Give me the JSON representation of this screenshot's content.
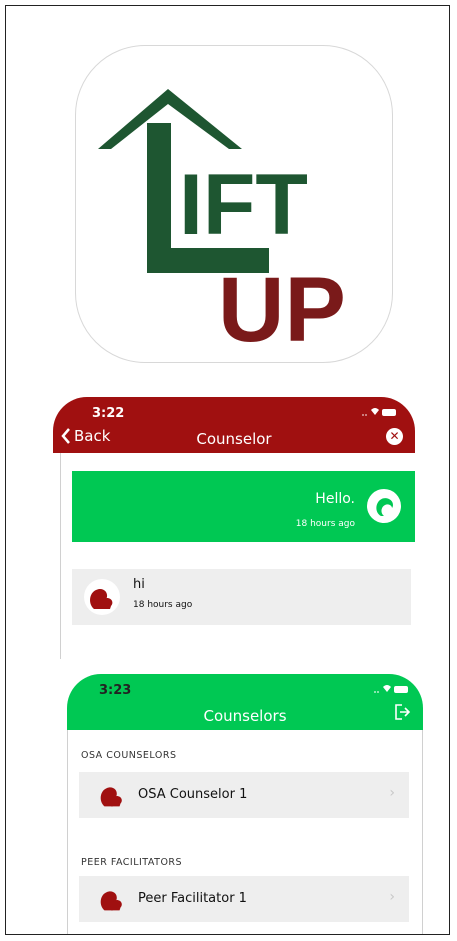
{
  "colors": {
    "logo_green": "#1e5631",
    "logo_maroon": "#7a1a1a",
    "nav_red": "#a01010",
    "nav_green": "#00c853",
    "bubble_grey": "#eeeeee"
  },
  "app_icon": {
    "logo_text_line1": "LIFT",
    "logo_text_line2": "UP"
  },
  "chat_screen": {
    "status_time": "3:22",
    "back_label": "Back",
    "title": "Counselor",
    "close_icon": "close-circle-icon",
    "messages": [
      {
        "text": "Hello.",
        "time": "18 hours ago",
        "side": "right"
      },
      {
        "text": "hi",
        "time": "18 hours ago",
        "side": "left"
      }
    ]
  },
  "counselors_screen": {
    "status_time": "3:23",
    "title": "Counselors",
    "logout_icon": "logout-icon",
    "sections": [
      {
        "label": "OSA COUNSELORS",
        "items": [
          "OSA Counselor 1"
        ]
      },
      {
        "label": "PEER FACILITATORS",
        "items": [
          "Peer Facilitator 1"
        ]
      }
    ]
  }
}
